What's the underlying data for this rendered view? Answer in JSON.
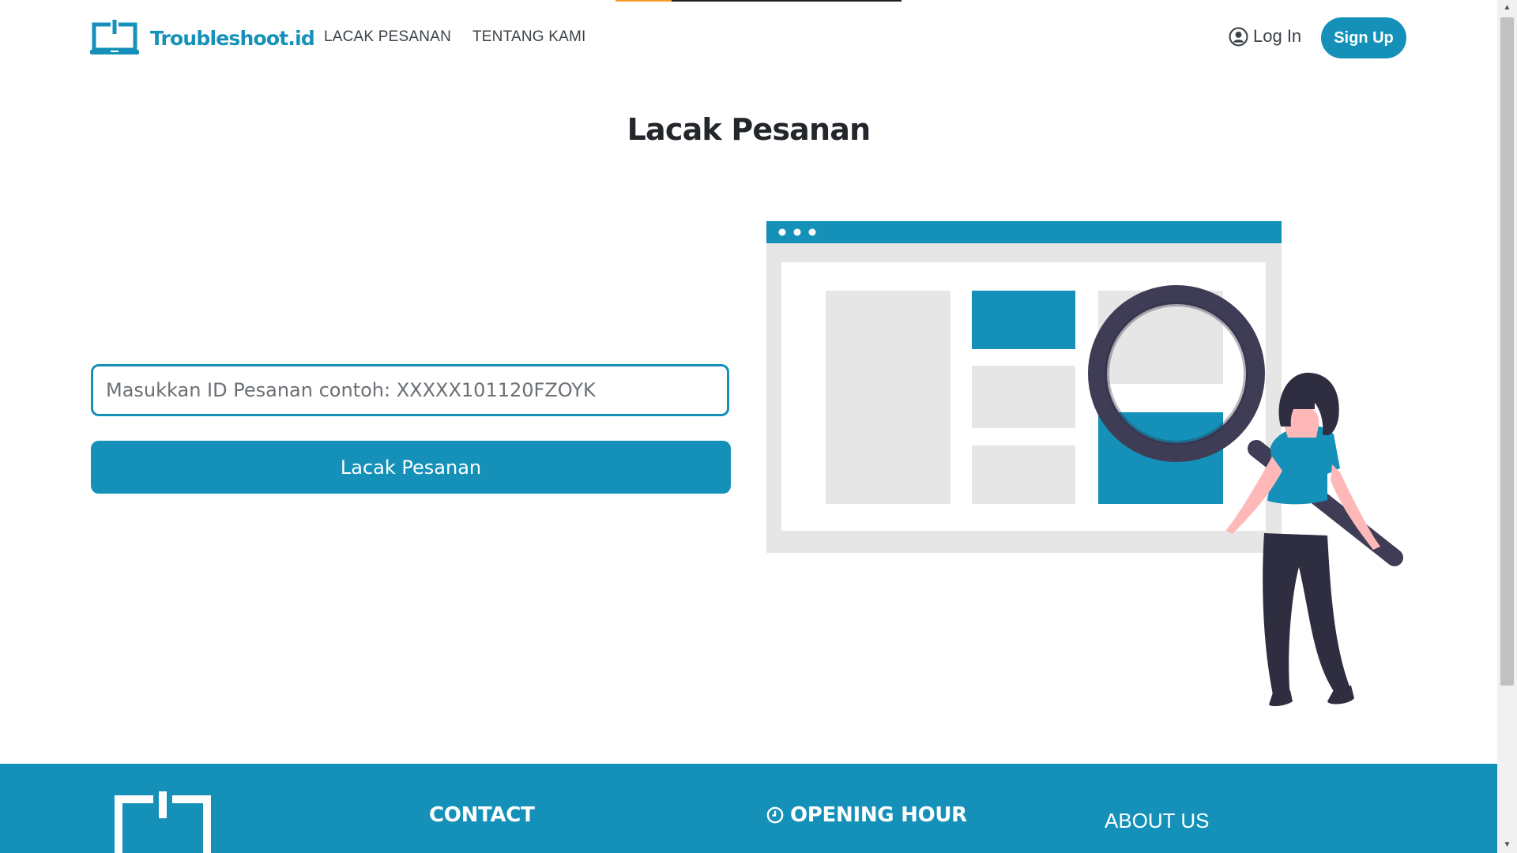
{
  "brand": {
    "name": "Troubleshoot.id",
    "color": "#1591b9",
    "icon": "laptop-power-icon"
  },
  "nav": {
    "items": [
      {
        "label": "LACAK PESANAN"
      },
      {
        "label": "TENTANG KAMI"
      }
    ]
  },
  "auth": {
    "login_label": "Log In",
    "signup_label": "Sign Up",
    "user_icon": "user-circle-icon"
  },
  "page": {
    "title": "Lacak Pesanan"
  },
  "form": {
    "order_id_placeholder": "Masukkan ID Pesanan contoh: XXXXX101120FZOYK",
    "order_id_value": "",
    "submit_label": "Lacak Pesanan"
  },
  "illustration": {
    "name": "woman-with-magnifying-glass-illustration"
  },
  "footer": {
    "contact_heading": "CONTACT",
    "opening_heading": "OPENING HOUR",
    "opening_icon": "clock-icon",
    "about_label": "ABOUT US"
  },
  "colors": {
    "accent": "#1591b9",
    "progress": "#f39c2a",
    "text_dark": "#23272b"
  }
}
